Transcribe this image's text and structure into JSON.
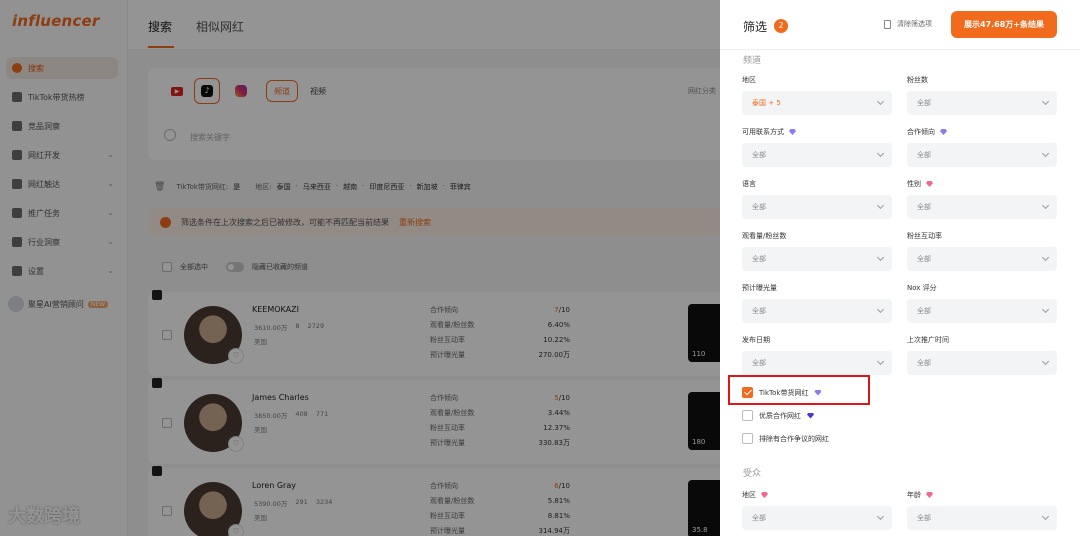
{
  "app": {
    "logo": "influencer",
    "sidebar": [
      {
        "label": "搜索",
        "active": true,
        "has_arrow": false
      },
      {
        "label": "TikTok带货热榜",
        "active": false,
        "has_arrow": false
      },
      {
        "label": "竞品洞察",
        "active": false,
        "has_arrow": false
      },
      {
        "label": "网红开发",
        "active": false,
        "has_arrow": true
      },
      {
        "label": "网红触达",
        "active": false,
        "has_arrow": true
      },
      {
        "label": "推广任务",
        "active": false,
        "has_arrow": true
      },
      {
        "label": "行业洞察",
        "active": false,
        "has_arrow": true
      },
      {
        "label": "设置",
        "active": false,
        "has_arrow": true
      }
    ],
    "ai_assistant": {
      "label": "聚星AI营销顾问",
      "badge": "NEW"
    },
    "tabs": [
      "搜索",
      "相似网红"
    ],
    "platform_chips": [
      "频道",
      "视频"
    ],
    "category_filter": "网红分类",
    "search_placeholder": "搜索关键字",
    "filter_summary": {
      "tiktok_label": "TikTok带货网红:",
      "tiktok_value": "是",
      "region_label": "地区:",
      "regions": [
        "泰国",
        "马来西亚",
        "越南",
        "印度尼西亚",
        "新加坡",
        "菲律宾"
      ]
    },
    "warning": {
      "text": "筛选条件在上次搜索之后已被修改，可能不再匹配当前结果",
      "link": "重新搜索"
    },
    "select_all": "全部选中",
    "hide_collected": "隐藏已收藏的频道",
    "metric_labels": [
      "合作倾向",
      "观看量/粉丝数",
      "粉丝互动率",
      "预计曝光量"
    ],
    "influencers": [
      {
        "name": "KEEMOKAZI",
        "followers": "3610.00万",
        "following": "8",
        "videos": "2729",
        "location": "美国",
        "score": "7",
        "score_suffix": "/10",
        "view_ratio": "6.40%",
        "engagement": "10.22%",
        "exposure": "270.00万",
        "video_views": "110"
      },
      {
        "name": "James Charles",
        "followers": "3850.00万",
        "following": "408",
        "videos": "771",
        "location": "美国",
        "score": "5",
        "score_suffix": "/10",
        "view_ratio": "3.44%",
        "engagement": "12.37%",
        "exposure": "330.83万",
        "video_views": "180"
      },
      {
        "name": "Loren Gray",
        "followers": "5390.00万",
        "following": "291",
        "videos": "3234",
        "location": "美国",
        "score": "6",
        "score_suffix": "/10",
        "view_ratio": "5.81%",
        "engagement": "8.81%",
        "exposure": "314.94万",
        "video_views": "35.8"
      }
    ],
    "watermark": "大数跨境"
  },
  "drawer": {
    "title": "筛选",
    "count": "2",
    "clear_label": "清除筛选项",
    "show_button": "展示47.68万+条结果",
    "channel_section": "频道",
    "audience_section": "受众",
    "fields": [
      {
        "label": "地区",
        "value": "泰国 + 5",
        "gem": null,
        "active": true
      },
      {
        "label": "粉丝数",
        "value": "全部",
        "gem": null,
        "active": false
      },
      {
        "label": "可用联系方式",
        "value": "全部",
        "gem": "purple",
        "active": false
      },
      {
        "label": "合作倾向",
        "value": "全部",
        "gem": "purple",
        "active": false
      },
      {
        "label": "语言",
        "value": "全部",
        "gem": null,
        "active": false
      },
      {
        "label": "性别",
        "value": "全部",
        "gem": "pink",
        "active": false
      },
      {
        "label": "观看量/粉丝数",
        "value": "全部",
        "gem": null,
        "active": false
      },
      {
        "label": "粉丝互动率",
        "value": "全部",
        "gem": null,
        "active": false
      },
      {
        "label": "预计曝光量",
        "value": "全部",
        "gem": null,
        "active": false
      },
      {
        "label": "Nox 评分",
        "value": "全部",
        "gem": null,
        "active": false
      },
      {
        "label": "发布日期",
        "value": "全部",
        "gem": null,
        "active": false
      },
      {
        "label": "上次推广时间",
        "value": "全部",
        "gem": null,
        "active": false
      }
    ],
    "checkboxes": [
      {
        "label": "TikTok带货网红",
        "checked": true,
        "gem": "purple"
      },
      {
        "label": "优质合作网红",
        "checked": false,
        "gem": "dark"
      },
      {
        "label": "排除有合作争议的网红",
        "checked": false,
        "gem": null
      }
    ],
    "audience_fields": [
      {
        "label": "地区",
        "value": "全部",
        "gem": "pink"
      },
      {
        "label": "年龄",
        "value": "全部",
        "gem": "pink"
      }
    ]
  },
  "colors": {
    "accent": "#f26b1d",
    "highlight_box": "#e01616"
  }
}
